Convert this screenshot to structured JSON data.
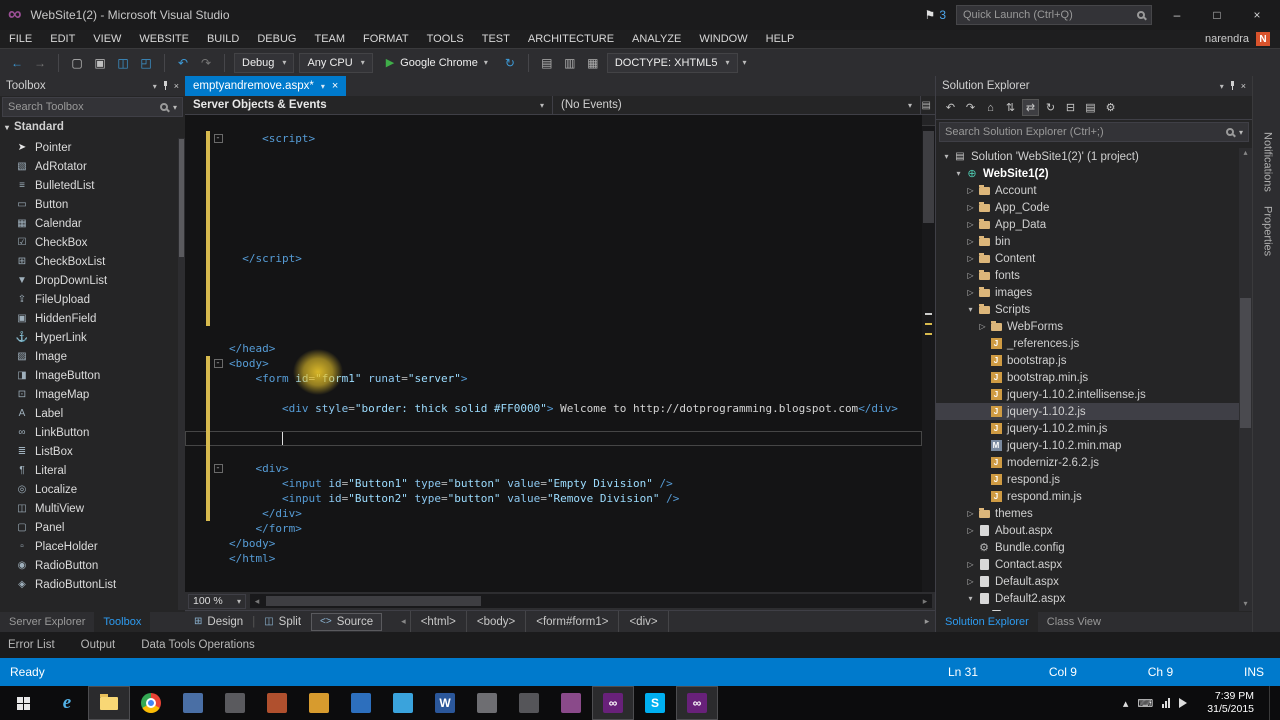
{
  "title_bar": {
    "title": "WebSite1(2) - Microsoft Visual Studio",
    "notification_count": "3",
    "quick_launch_placeholder": "Quick Launch (Ctrl+Q)"
  },
  "menu_bar": {
    "items": [
      "FILE",
      "EDIT",
      "VIEW",
      "WEBSITE",
      "BUILD",
      "DEBUG",
      "TEAM",
      "FORMAT",
      "TOOLS",
      "TEST",
      "ARCHITECTURE",
      "ANALYZE",
      "WINDOW",
      "HELP"
    ],
    "user_name": "narendra",
    "user_badge": "N"
  },
  "toolbar": {
    "debug_target": "Debug",
    "platform": "Any CPU",
    "run_browser": "Google Chrome",
    "doctype_label": "DOCTYPE: XHTML5",
    "nav_icons": [
      {
        "name": "nav-back-icon",
        "glyph": "←",
        "color": "#3d9bd8"
      },
      {
        "name": "nav-forward-icon",
        "glyph": "→",
        "color": "#777777"
      }
    ],
    "file_icons": [
      {
        "name": "new-file-icon",
        "glyph": "▢",
        "color": "#c0c0c0"
      },
      {
        "name": "open-file-icon",
        "glyph": "▣",
        "color": "#c0c0c0"
      },
      {
        "name": "save-icon",
        "glyph": "◫",
        "color": "#3d9bd8"
      },
      {
        "name": "save-all-icon",
        "glyph": "◰",
        "color": "#3d9bd8"
      }
    ],
    "edit_icons": [
      {
        "name": "undo-icon",
        "glyph": "↶",
        "color": "#3d9bd8"
      },
      {
        "name": "redo-icon",
        "glyph": "↷",
        "color": "#777777"
      }
    ],
    "refresh_icon": {
      "name": "refresh-icon",
      "glyph": "↻",
      "color": "#3d9bd8"
    },
    "doc_icons": [
      {
        "name": "doc-outline-icon-1",
        "glyph": "▤",
        "color": "#b0b0b0"
      },
      {
        "name": "doc-outline-icon-2",
        "glyph": "▥",
        "color": "#b0b0b0"
      },
      {
        "name": "doc-outline-icon-3",
        "glyph": "▦",
        "color": "#b0b0b0"
      }
    ]
  },
  "toolbox": {
    "title": "Toolbox",
    "search_placeholder": "Search Toolbox",
    "section_label": "Standard",
    "items": [
      {
        "label": "Pointer",
        "icon": "pointer-icon",
        "glyph": "➤"
      },
      {
        "label": "AdRotator",
        "icon": "adrotator-icon",
        "glyph": "▧"
      },
      {
        "label": "BulletedList",
        "icon": "bulletedlist-icon",
        "glyph": "≡"
      },
      {
        "label": "Button",
        "icon": "button-icon",
        "glyph": "▭"
      },
      {
        "label": "Calendar",
        "icon": "calendar-icon",
        "glyph": "▦"
      },
      {
        "label": "CheckBox",
        "icon": "checkbox-icon",
        "glyph": "☑"
      },
      {
        "label": "CheckBoxList",
        "icon": "checkboxlist-icon",
        "glyph": "⊞"
      },
      {
        "label": "DropDownList",
        "icon": "dropdownlist-icon",
        "glyph": "▼"
      },
      {
        "label": "FileUpload",
        "icon": "fileupload-icon",
        "glyph": "⇪"
      },
      {
        "label": "HiddenField",
        "icon": "hiddenfield-icon",
        "glyph": "▣"
      },
      {
        "label": "HyperLink",
        "icon": "hyperlink-icon",
        "glyph": "⚓"
      },
      {
        "label": "Image",
        "icon": "image-icon",
        "glyph": "▨"
      },
      {
        "label": "ImageButton",
        "icon": "imagebutton-icon",
        "glyph": "◨"
      },
      {
        "label": "ImageMap",
        "icon": "imagemap-icon",
        "glyph": "⊡"
      },
      {
        "label": "Label",
        "icon": "label-icon",
        "glyph": "A"
      },
      {
        "label": "LinkButton",
        "icon": "linkbutton-icon",
        "glyph": "∞"
      },
      {
        "label": "ListBox",
        "icon": "listbox-icon",
        "glyph": "≣"
      },
      {
        "label": "Literal",
        "icon": "literal-icon",
        "glyph": "¶"
      },
      {
        "label": "Localize",
        "icon": "localize-icon",
        "glyph": "◎"
      },
      {
        "label": "MultiView",
        "icon": "multiview-icon",
        "glyph": "◫"
      },
      {
        "label": "Panel",
        "icon": "panel-icon",
        "glyph": "▢"
      },
      {
        "label": "PlaceHolder",
        "icon": "placeholder-icon",
        "glyph": "▫"
      },
      {
        "label": "RadioButton",
        "icon": "radiobutton-icon",
        "glyph": "◉"
      },
      {
        "label": "RadioButtonList",
        "icon": "radiobuttonlist-icon",
        "glyph": "◈"
      }
    ]
  },
  "panel_tabs_left": [
    {
      "label": "Server Explorer",
      "active": false
    },
    {
      "label": "Toolbox",
      "active": true
    }
  ],
  "editor": {
    "tab": {
      "label": "emptyandremove.aspx*"
    },
    "object_dropdown": "Server Objects & Events",
    "event_dropdown": "(No Events)",
    "zoom": "100 %",
    "views": [
      {
        "label": "Design",
        "glyph": "⊞"
      },
      {
        "label": "Split",
        "glyph": "◫"
      },
      {
        "label": "Source",
        "glyph": "<>",
        "active": true
      }
    ],
    "breadcrumbs": [
      "<html>",
      "<body>",
      "<form#form1>",
      "<div>"
    ],
    "lines": [
      {
        "sp": 5,
        "fold": true,
        "chg": true,
        "tk": [
          [
            "t",
            "<script>"
          ]
        ]
      },
      {
        "sp": 0,
        "chg": true,
        "tk": []
      },
      {
        "sp": 0,
        "chg": true,
        "tk": []
      },
      {
        "sp": 0,
        "chg": true,
        "tk": []
      },
      {
        "sp": 0,
        "chg": true,
        "tk": []
      },
      {
        "sp": 0,
        "chg": true,
        "tk": []
      },
      {
        "sp": 0,
        "chg": true,
        "tk": []
      },
      {
        "sp": 0,
        "chg": true,
        "tk": []
      },
      {
        "sp": 2,
        "chg": true,
        "tk": [
          [
            "t",
            "</script>"
          ]
        ]
      },
      {
        "sp": 0,
        "chg": true,
        "tk": []
      },
      {
        "sp": 0,
        "chg": true,
        "tk": []
      },
      {
        "sp": 0,
        "chg": true,
        "tk": []
      },
      {
        "sp": 0,
        "chg": true,
        "tk": []
      },
      {
        "sp": 0,
        "tk": []
      },
      {
        "sp": 0,
        "tk": [
          [
            "t",
            "</head>"
          ]
        ]
      },
      {
        "sp": 0,
        "fold": true,
        "chg": true,
        "tk": [
          [
            "t",
            "<body>"
          ]
        ]
      },
      {
        "sp": 4,
        "chg": true,
        "tk": [
          [
            "t",
            "<form "
          ],
          [
            "a",
            "id"
          ],
          [
            "o",
            "="
          ],
          [
            "v",
            "\"form1\""
          ],
          [
            "x",
            " "
          ],
          [
            "a",
            "runat"
          ],
          [
            "o",
            "="
          ],
          [
            "v",
            "\"server\""
          ],
          [
            "t",
            ">"
          ]
        ]
      },
      {
        "sp": 0,
        "chg": true,
        "tk": []
      },
      {
        "sp": 8,
        "chg": true,
        "tk": [
          [
            "t",
            "<div "
          ],
          [
            "a",
            "style"
          ],
          [
            "o",
            "="
          ],
          [
            "v",
            "\"border: thick solid #FF0000\""
          ],
          [
            "t",
            ">"
          ],
          [
            "x",
            " Welcome to http://dotprogramming.blogspot.com"
          ],
          [
            "t",
            "</div>"
          ]
        ]
      },
      {
        "sp": 0,
        "chg": true,
        "tk": []
      },
      {
        "sp": 0,
        "chg": true,
        "cur": true,
        "tk": []
      },
      {
        "sp": 0,
        "chg": true,
        "tk": []
      },
      {
        "sp": 4,
        "fold": true,
        "chg": true,
        "tk": [
          [
            "t",
            "<div>"
          ]
        ]
      },
      {
        "sp": 8,
        "chg": true,
        "tk": [
          [
            "t",
            "<input "
          ],
          [
            "a",
            "id"
          ],
          [
            "o",
            "="
          ],
          [
            "v",
            "\"Button1\""
          ],
          [
            "x",
            " "
          ],
          [
            "a",
            "type"
          ],
          [
            "o",
            "="
          ],
          [
            "v",
            "\"button\""
          ],
          [
            "x",
            " "
          ],
          [
            "a",
            "value"
          ],
          [
            "o",
            "="
          ],
          [
            "v",
            "\"Empty Division\""
          ],
          [
            "t",
            " />"
          ]
        ]
      },
      {
        "sp": 8,
        "chg": true,
        "tk": [
          [
            "t",
            "<input "
          ],
          [
            "a",
            "id"
          ],
          [
            "o",
            "="
          ],
          [
            "v",
            "\"Button2\""
          ],
          [
            "x",
            " "
          ],
          [
            "a",
            "type"
          ],
          [
            "o",
            "="
          ],
          [
            "v",
            "\"button\""
          ],
          [
            "x",
            " "
          ],
          [
            "a",
            "value"
          ],
          [
            "o",
            "="
          ],
          [
            "v",
            "\"Remove Division\""
          ],
          [
            "t",
            " />"
          ]
        ]
      },
      {
        "sp": 5,
        "chg": true,
        "tk": [
          [
            "t",
            "</div>"
          ]
        ]
      },
      {
        "sp": 4,
        "tk": [
          [
            "t",
            "</form>"
          ]
        ]
      },
      {
        "sp": 0,
        "tk": [
          [
            "t",
            "</body>"
          ]
        ]
      },
      {
        "sp": 0,
        "tk": [
          [
            "t",
            "</html>"
          ]
        ]
      }
    ]
  },
  "solution_explorer": {
    "title": "Solution Explorer",
    "search_placeholder": "Search Solution Explorer (Ctrl+;)",
    "toolbar_icons": [
      {
        "name": "back-icon",
        "glyph": "↶"
      },
      {
        "name": "forward-icon",
        "glyph": "↷"
      },
      {
        "name": "home-icon",
        "glyph": "⌂"
      },
      {
        "name": "switch-views-icon",
        "glyph": "⇅"
      },
      {
        "name": "sync-active-document-icon",
        "glyph": "⇄",
        "active": true
      },
      {
        "name": "refresh-icon",
        "glyph": "↻"
      },
      {
        "name": "collapse-all-icon",
        "glyph": "⊟"
      },
      {
        "name": "show-all-files-icon",
        "glyph": "▤"
      },
      {
        "name": "properties-icon",
        "glyph": "⚙"
      }
    ],
    "items": [
      {
        "depth": 0,
        "arrow": "down",
        "icon": "solution",
        "label": "Solution 'WebSite1(2)' (1 project)"
      },
      {
        "depth": 1,
        "arrow": "down",
        "icon": "website",
        "label": "WebSite1(2)",
        "bold": true
      },
      {
        "depth": 2,
        "arrow": "right",
        "icon": "folder",
        "label": "Account"
      },
      {
        "depth": 2,
        "arrow": "right",
        "icon": "folder",
        "label": "App_Code"
      },
      {
        "depth": 2,
        "arrow": "right",
        "icon": "folder",
        "label": "App_Data"
      },
      {
        "depth": 2,
        "arrow": "right",
        "icon": "folder",
        "label": "bin"
      },
      {
        "depth": 2,
        "arrow": "right",
        "icon": "folder",
        "label": "Content"
      },
      {
        "depth": 2,
        "arrow": "right",
        "icon": "folder",
        "label": "fonts"
      },
      {
        "depth": 2,
        "arrow": "right",
        "icon": "folder",
        "label": "images"
      },
      {
        "depth": 2,
        "arrow": "down",
        "icon": "folder",
        "label": "Scripts"
      },
      {
        "depth": 3,
        "arrow": "right",
        "icon": "folder",
        "label": "WebForms"
      },
      {
        "depth": 3,
        "icon": "js",
        "label": "_references.js"
      },
      {
        "depth": 3,
        "icon": "js",
        "label": "bootstrap.js"
      },
      {
        "depth": 3,
        "icon": "js",
        "label": "bootstrap.min.js"
      },
      {
        "depth": 3,
        "icon": "js",
        "label": "jquery-1.10.2.intellisense.js"
      },
      {
        "depth": 3,
        "icon": "js",
        "label": "jquery-1.10.2.js",
        "selected": true
      },
      {
        "depth": 3,
        "icon": "js",
        "label": "jquery-1.10.2.min.js"
      },
      {
        "depth": 3,
        "icon": "map",
        "label": "jquery-1.10.2.min.map"
      },
      {
        "depth": 3,
        "icon": "js",
        "label": "modernizr-2.6.2.js"
      },
      {
        "depth": 3,
        "icon": "js",
        "label": "respond.js"
      },
      {
        "depth": 3,
        "icon": "js",
        "label": "respond.min.js"
      },
      {
        "depth": 2,
        "arrow": "right",
        "icon": "folder",
        "label": "themes"
      },
      {
        "depth": 2,
        "arrow": "right",
        "icon": "aspx",
        "label": "About.aspx"
      },
      {
        "depth": 2,
        "icon": "config",
        "label": "Bundle.config"
      },
      {
        "depth": 2,
        "arrow": "right",
        "icon": "aspx",
        "label": "Contact.aspx"
      },
      {
        "depth": 2,
        "arrow": "right",
        "icon": "aspx",
        "label": "Default.aspx"
      },
      {
        "depth": 2,
        "arrow": "down",
        "icon": "aspx",
        "label": "Default2.aspx"
      },
      {
        "depth": 3,
        "icon": "aspx",
        "label": ""
      }
    ],
    "tabs": [
      {
        "label": "Solution Explorer",
        "active": true
      },
      {
        "label": "Class View",
        "active": false
      }
    ]
  },
  "edge_labels": [
    "Notifications",
    "Properties"
  ],
  "bottom_tool_tabs": [
    "Error List",
    "Output",
    "Data Tools Operations"
  ],
  "status_bar": {
    "message": "Ready",
    "line": "Ln 31",
    "column": "Col 9",
    "character": "Ch 9",
    "mode": "INS"
  },
  "taskbar": {
    "apps": [
      {
        "name": "internet-explorer",
        "kind": "ie"
      },
      {
        "name": "file-explorer",
        "kind": "folder",
        "active": true
      },
      {
        "name": "chrome",
        "kind": "chrome"
      },
      {
        "name": "app-photos",
        "kind": "block",
        "color": "#4a6fa5"
      },
      {
        "name": "app-editor",
        "kind": "block",
        "color": "#5a5a5e"
      },
      {
        "name": "app-red",
        "kind": "block",
        "color": "#b0502e"
      },
      {
        "name": "app-paint",
        "kind": "block",
        "color": "#d79b2e"
      },
      {
        "name": "app-blue",
        "kind": "block",
        "color": "#2d6fbd"
      },
      {
        "name": "app-media",
        "kind": "block",
        "color": "#3aa3dc"
      },
      {
        "name": "word",
        "kind": "letter",
        "glyph": "W",
        "color": "#2b579a"
      },
      {
        "name": "app-gray",
        "kind": "block",
        "color": "#6e6e72"
      },
      {
        "name": "app-pen",
        "kind": "block",
        "color": "#555559"
      },
      {
        "name": "app-magenta",
        "kind": "block",
        "color": "#8a4a8a"
      },
      {
        "name": "visual-studio-1",
        "kind": "vs",
        "color": "#68217a",
        "active": true
      },
      {
        "name": "app-skype",
        "kind": "letter",
        "glyph": "S",
        "color": "#00aff0"
      },
      {
        "name": "visual-studio-2",
        "kind": "vs",
        "color": "#68217a",
        "active": true
      }
    ],
    "tray_time": "7:39 PM",
    "tray_date": "31/5/2015"
  }
}
